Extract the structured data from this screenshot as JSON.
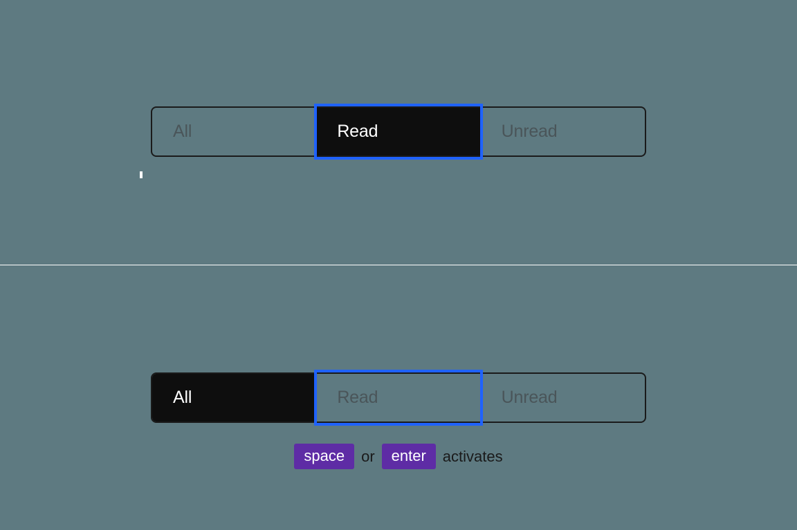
{
  "example_top": {
    "segments": [
      {
        "label": "All"
      },
      {
        "label": "Read"
      },
      {
        "label": "Unread"
      }
    ],
    "selected_index": 1,
    "focused_index": 1
  },
  "example_bottom": {
    "segments": [
      {
        "label": "All"
      },
      {
        "label": "Read"
      },
      {
        "label": "Unread"
      }
    ],
    "selected_index": 0,
    "focused_index": 1,
    "hint": {
      "key1": "space",
      "or": "or",
      "key2": "enter",
      "action": "activates"
    }
  }
}
